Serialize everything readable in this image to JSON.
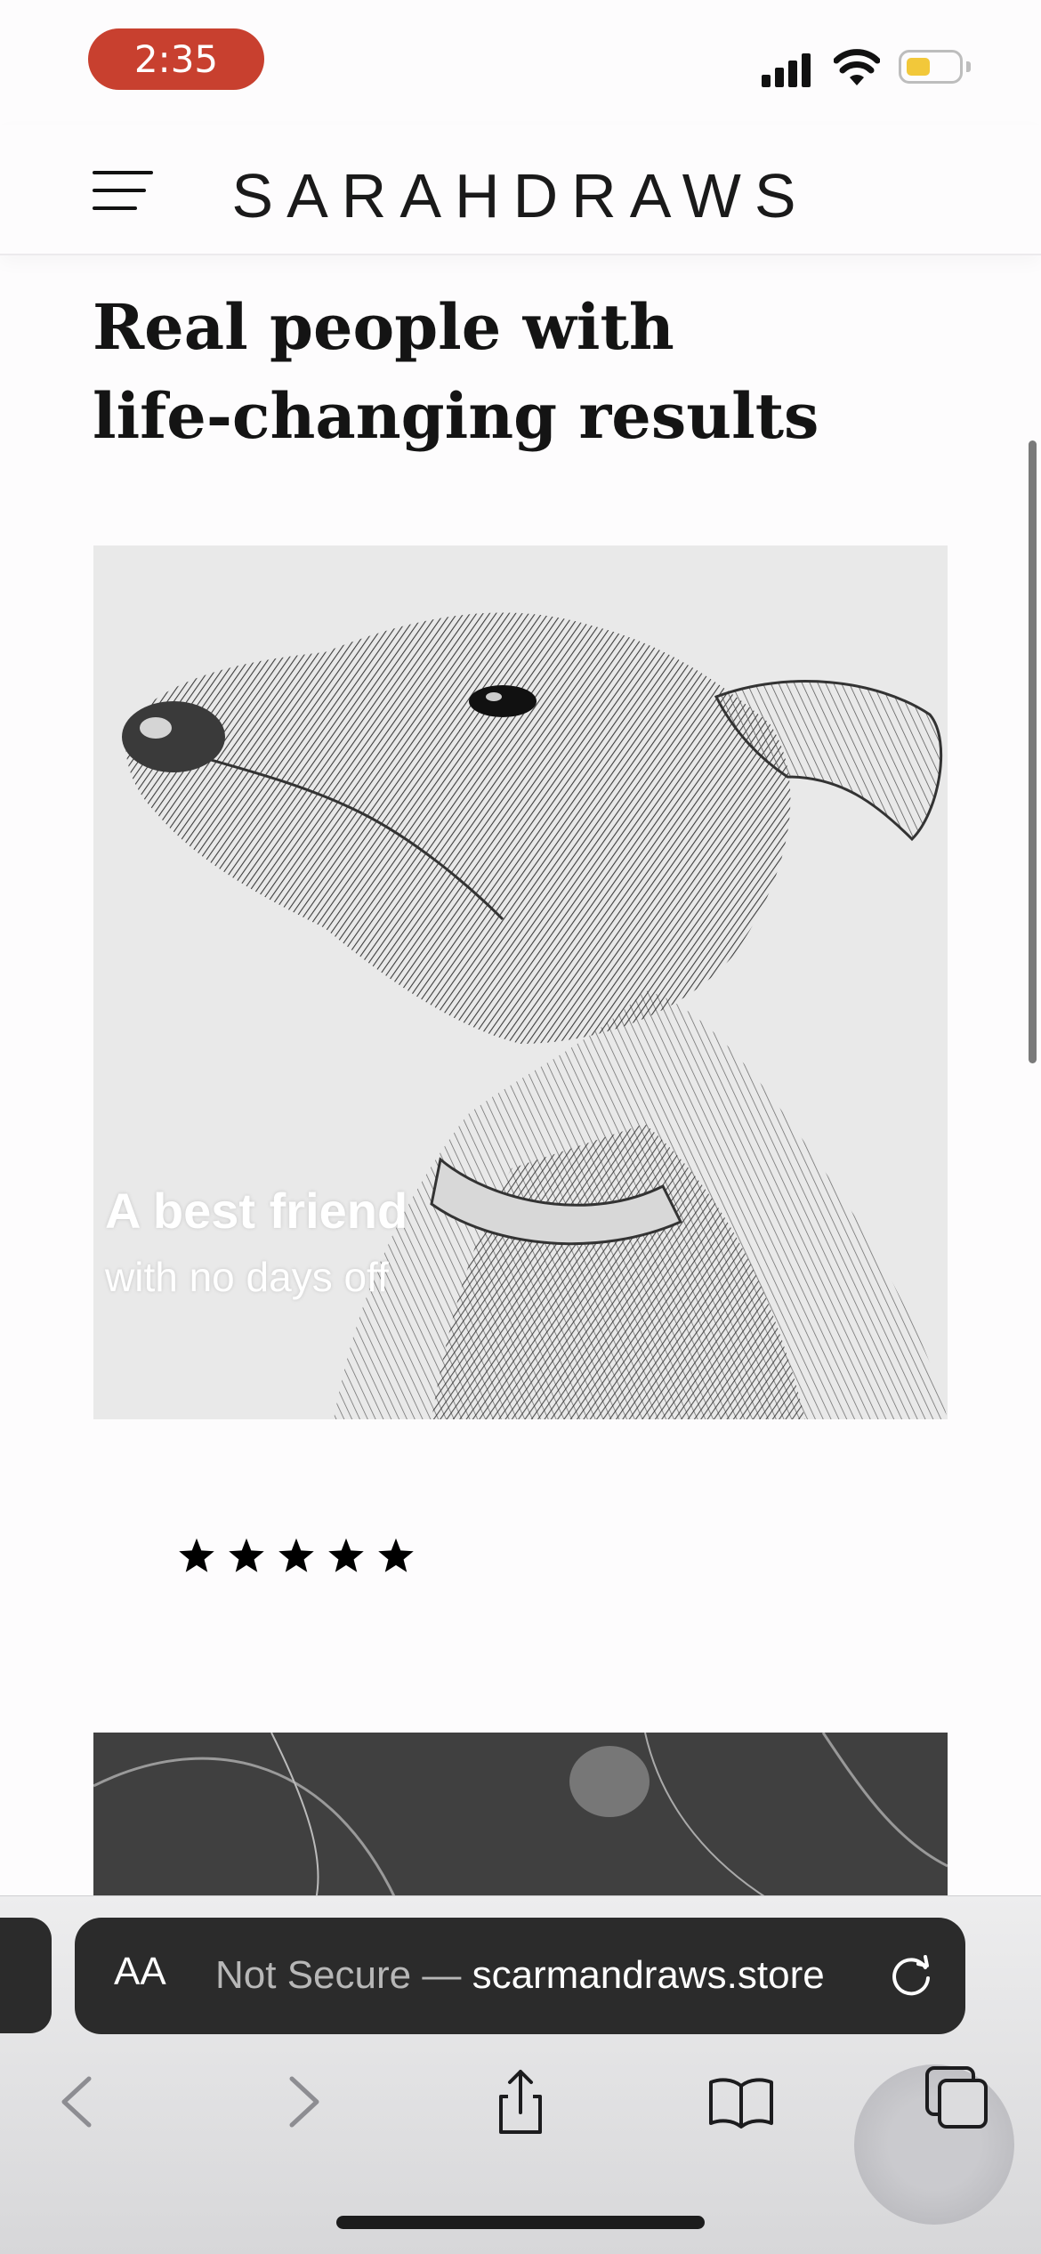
{
  "status_bar": {
    "time": "2:35"
  },
  "site": {
    "logo": "SARAHDRAWS"
  },
  "section": {
    "heading_line1": "Real people with",
    "heading_line2": "life-changing results"
  },
  "card": {
    "title": "A best friend",
    "subtitle": "with no days off"
  },
  "rating": {
    "stars": 5,
    "max": 5
  },
  "browser": {
    "aa_label": "AA",
    "security_text": "Not Secure — ",
    "domain": "scarmandraws.store"
  },
  "icons": {
    "menu": "hamburger-menu-icon",
    "back": "chevron-left-icon",
    "forward": "chevron-right-icon",
    "share": "share-icon",
    "bookmarks": "book-icon",
    "tabs": "tabs-icon",
    "reload": "reload-icon"
  },
  "colors": {
    "time_pill": "#c8402f",
    "battery": "#f2c83a",
    "url_bar": "#2b2b2b"
  }
}
